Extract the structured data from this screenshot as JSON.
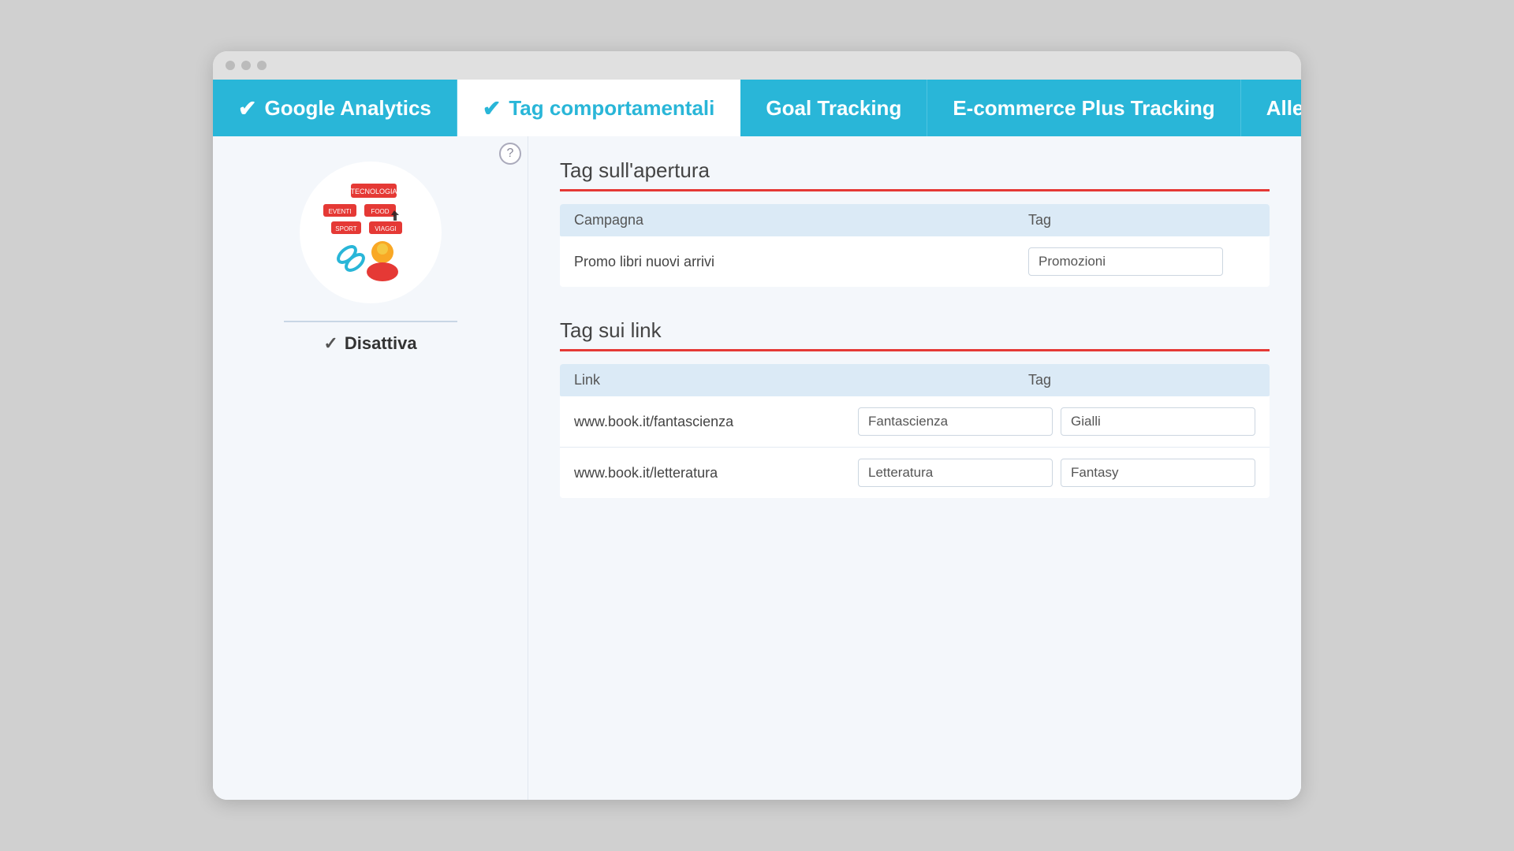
{
  "tabs": [
    {
      "id": "google-analytics",
      "label": "Google Analytics",
      "hasCheck": true,
      "active": false
    },
    {
      "id": "tag-comportamentali",
      "label": "Tag comportamentali",
      "hasCheck": true,
      "active": true
    },
    {
      "id": "goal-tracking",
      "label": "Goal Tracking",
      "hasCheck": false,
      "active": false
    },
    {
      "id": "ecommerce-plus",
      "label": "E-commerce Plus Tracking",
      "hasCheck": false,
      "active": false
    },
    {
      "id": "allegati",
      "label": "Allegati",
      "hasCheck": false,
      "active": false
    }
  ],
  "sidebar": {
    "disattiva_label": "Disattiva",
    "help_symbol": "?"
  },
  "tag_apertura": {
    "title": "Tag sull'apertura",
    "columns": [
      "Campagna",
      "Tag"
    ],
    "rows": [
      {
        "campagna": "Promo libri nuovi arrivi",
        "tag": "Promozioni"
      }
    ]
  },
  "tag_link": {
    "title": "Tag sui link",
    "columns": [
      "Link",
      "Tag"
    ],
    "rows": [
      {
        "link": "www.book.it/fantascienza",
        "tag1": "Fantascienza",
        "tag2": "Gialli"
      },
      {
        "link": "www.book.it/letteratura",
        "tag1": "Letteratura",
        "tag2": "Fantasy"
      }
    ]
  }
}
